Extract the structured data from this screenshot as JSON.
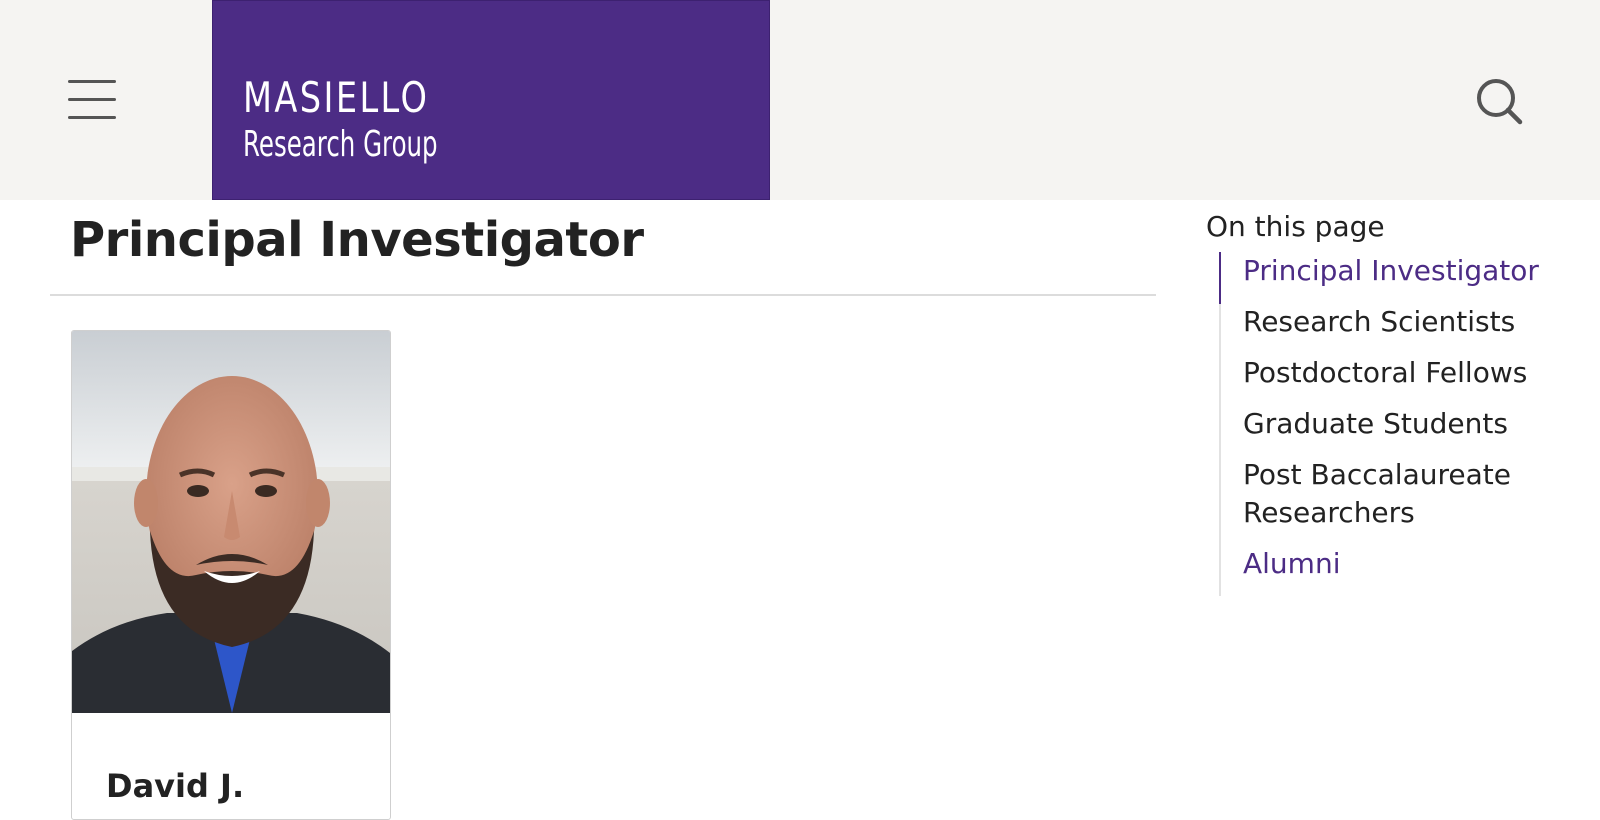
{
  "header": {
    "menu_icon": "hamburger-menu-icon",
    "logo": {
      "line1": "MASIELLO",
      "line2": "Research Group",
      "background": "#4c2c85"
    },
    "search_icon": "search-icon"
  },
  "main": {
    "section_title": "Principal Investigator",
    "profile": {
      "name": "David J."
    }
  },
  "toc": {
    "heading": "On this page",
    "items": [
      {
        "label": "Principal Investigator"
      },
      {
        "label": "Research Scientists"
      },
      {
        "label": "Postdoctoral Fellows"
      },
      {
        "label": "Graduate Students"
      },
      {
        "label": "Post Baccalaureate Researchers"
      },
      {
        "label": "Alumni"
      }
    ]
  },
  "colors": {
    "brand_purple": "#4c2c85",
    "header_bg": "#f5f4f2",
    "text": "#222222"
  }
}
